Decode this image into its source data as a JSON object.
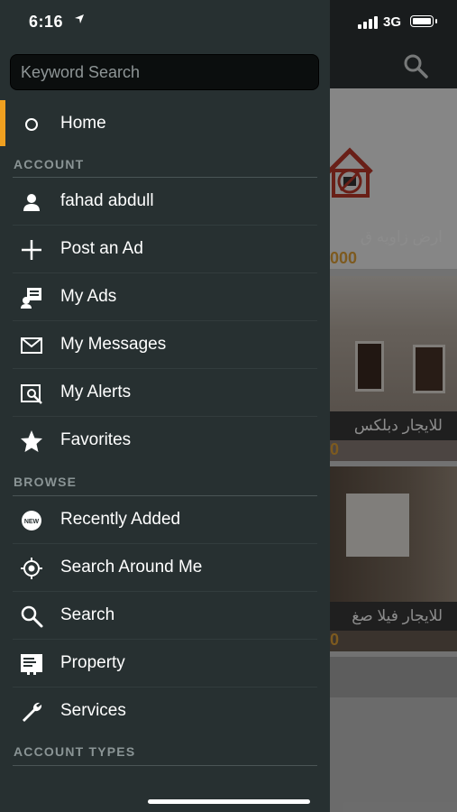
{
  "status_bar": {
    "time": "6:16",
    "network": "3G"
  },
  "drawer": {
    "search_placeholder": "Keyword Search",
    "home_label": "Home",
    "account_section": "ACCOUNT",
    "account_items": [
      {
        "label": "fahad abdull",
        "icon": "user-icon"
      },
      {
        "label": "Post an Ad",
        "icon": "plus-icon"
      },
      {
        "label": "My Ads",
        "icon": "my-ads-icon"
      },
      {
        "label": "My Messages",
        "icon": "envelope-icon"
      },
      {
        "label": "My Alerts",
        "icon": "alert-search-icon"
      },
      {
        "label": "Favorites",
        "icon": "star-icon"
      }
    ],
    "browse_section": "BROWSE",
    "browse_items": [
      {
        "label": "Recently Added",
        "icon": "new-badge-icon"
      },
      {
        "label": "Search Around Me",
        "icon": "location-target-icon"
      },
      {
        "label": "Search",
        "icon": "search-icon"
      },
      {
        "label": "Property",
        "icon": "property-icon"
      },
      {
        "label": "Services",
        "icon": "wrench-icon"
      }
    ],
    "account_types_section": "ACCOUNT TYPES",
    "accent_color": "#f0a020"
  },
  "background": {
    "listings": [
      {
        "title": "ارض زاويه ق",
        "price": "000"
      },
      {
        "title": "للايجار دبلكس",
        "price": "0"
      },
      {
        "title": "للايجار فيلا صغ",
        "price": "0"
      }
    ]
  }
}
